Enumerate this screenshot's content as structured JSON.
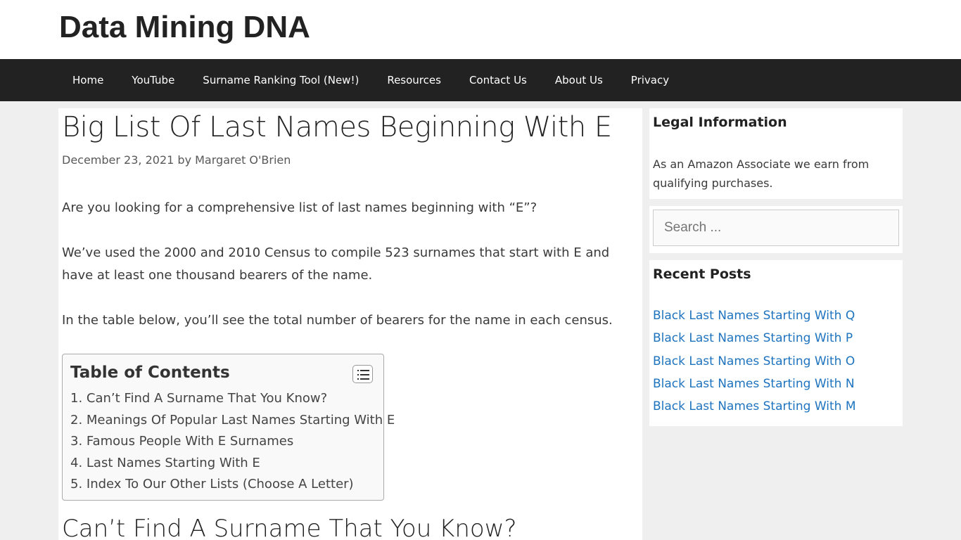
{
  "site": {
    "title": "Data Mining DNA"
  },
  "nav": {
    "items": [
      {
        "label": "Home"
      },
      {
        "label": "YouTube"
      },
      {
        "label": "Surname Ranking Tool (New!)"
      },
      {
        "label": "Resources"
      },
      {
        "label": "Contact Us"
      },
      {
        "label": "About Us"
      },
      {
        "label": "Privacy"
      }
    ]
  },
  "article": {
    "title": "Big List Of Last Names Beginning With E",
    "date": "December 23, 2021",
    "by": "by",
    "author": "Margaret O'Brien",
    "paragraphs": [
      "Are you looking for a comprehensive list of last names beginning with “E”?",
      "We’ve used the 2000 and 2010 Census to compile 523 surnames that start with E and have at least one thousand bearers of the name.",
      "In the table below, you’ll see the total number of bearers for the name in each census."
    ],
    "section_heading": "Can’t Find A Surname That You Know?"
  },
  "toc": {
    "title": "Table of Contents",
    "toggle_icon": "list-toggle-icon",
    "items": [
      {
        "label": "1. Can’t Find A Surname That You Know?"
      },
      {
        "label": "2. Meanings Of Popular Last Names Starting With E"
      },
      {
        "label": "3. Famous People With E Surnames"
      },
      {
        "label": "4. Last Names Starting With E"
      },
      {
        "label": "5. Index To Our Other Lists (Choose A Letter)"
      }
    ]
  },
  "sidebar": {
    "legal": {
      "title": "Legal Information",
      "text": "As an Amazon Associate we earn from qualifying purchases."
    },
    "search": {
      "placeholder": "Search ..."
    },
    "recent": {
      "title": "Recent Posts",
      "items": [
        {
          "label": "Black Last Names Starting With Q"
        },
        {
          "label": "Black Last Names Starting With P"
        },
        {
          "label": "Black Last Names Starting With O"
        },
        {
          "label": "Black Last Names Starting With N"
        },
        {
          "label": "Black Last Names Starting With M"
        }
      ]
    }
  },
  "colors": {
    "nav_bg": "#222222",
    "page_bg": "#efefef",
    "link": "#1e73be"
  }
}
